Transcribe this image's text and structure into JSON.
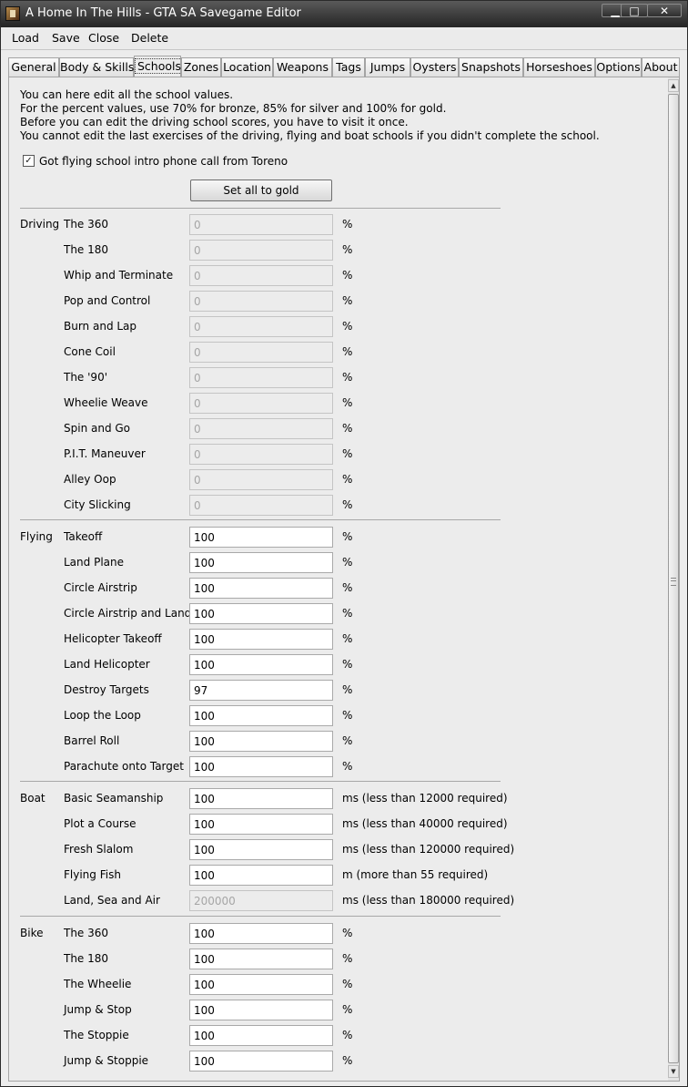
{
  "window": {
    "title": "A Home In The Hills - GTA SA Savegame Editor",
    "minimize": "▁",
    "maximize": "□",
    "close": "✕"
  },
  "menu": [
    "Load",
    "Save",
    "Close",
    "Delete"
  ],
  "tabs": [
    "General",
    "Body & Skills",
    "Schools",
    "Zones",
    "Location",
    "Weapons",
    "Tags",
    "Jumps",
    "Oysters",
    "Snapshots",
    "Horseshoes",
    "Options",
    "About"
  ],
  "active_tab": "Schools",
  "intro": [
    "You can here edit all the school values.",
    "For the percent values, use 70% for bronze, 85% for silver and 100% for gold.",
    "Before you can edit the driving school scores, you have to visit it once.",
    "You cannot edit the last exercises of the driving, flying and boat schools if you didn't complete the school."
  ],
  "phone_call_checkbox": {
    "label": "Got flying school intro phone call from Toreno",
    "checked": true,
    "mark": "✓"
  },
  "set_all_gold_label": "Set all to gold",
  "sections": [
    {
      "name": "Driving",
      "rows": [
        {
          "label": "The 360",
          "value": "0",
          "unit": "%",
          "disabled": true
        },
        {
          "label": "The 180",
          "value": "0",
          "unit": "%",
          "disabled": true
        },
        {
          "label": "Whip and Terminate",
          "value": "0",
          "unit": "%",
          "disabled": true
        },
        {
          "label": "Pop and Control",
          "value": "0",
          "unit": "%",
          "disabled": true
        },
        {
          "label": "Burn and Lap",
          "value": "0",
          "unit": "%",
          "disabled": true
        },
        {
          "label": "Cone Coil",
          "value": "0",
          "unit": "%",
          "disabled": true
        },
        {
          "label": "The '90'",
          "value": "0",
          "unit": "%",
          "disabled": true
        },
        {
          "label": "Wheelie Weave",
          "value": "0",
          "unit": "%",
          "disabled": true
        },
        {
          "label": "Spin and Go",
          "value": "0",
          "unit": "%",
          "disabled": true
        },
        {
          "label": "P.I.T. Maneuver",
          "value": "0",
          "unit": "%",
          "disabled": true
        },
        {
          "label": "Alley Oop",
          "value": "0",
          "unit": "%",
          "disabled": true
        },
        {
          "label": "City Slicking",
          "value": "0",
          "unit": "%",
          "disabled": true
        }
      ]
    },
    {
      "name": "Flying",
      "rows": [
        {
          "label": "Takeoff",
          "value": "100",
          "unit": "%",
          "disabled": false
        },
        {
          "label": "Land Plane",
          "value": "100",
          "unit": "%",
          "disabled": false
        },
        {
          "label": "Circle Airstrip",
          "value": "100",
          "unit": "%",
          "disabled": false
        },
        {
          "label": "Circle Airstrip and Land",
          "value": "100",
          "unit": "%",
          "disabled": false
        },
        {
          "label": "Helicopter Takeoff",
          "value": "100",
          "unit": "%",
          "disabled": false
        },
        {
          "label": "Land Helicopter",
          "value": "100",
          "unit": "%",
          "disabled": false
        },
        {
          "label": "Destroy Targets",
          "value": "97",
          "unit": "%",
          "disabled": false
        },
        {
          "label": "Loop the Loop",
          "value": "100",
          "unit": "%",
          "disabled": false
        },
        {
          "label": "Barrel Roll",
          "value": "100",
          "unit": "%",
          "disabled": false
        },
        {
          "label": "Parachute onto Target",
          "value": "100",
          "unit": "%",
          "disabled": false
        }
      ]
    },
    {
      "name": "Boat",
      "rows": [
        {
          "label": "Basic Seamanship",
          "value": "100",
          "unit": "ms (less than 12000 required)",
          "disabled": false
        },
        {
          "label": "Plot a Course",
          "value": "100",
          "unit": "ms (less than 40000 required)",
          "disabled": false
        },
        {
          "label": "Fresh Slalom",
          "value": "100",
          "unit": "ms (less than 120000 required)",
          "disabled": false
        },
        {
          "label": "Flying Fish",
          "value": "100",
          "unit": "m (more than 55 required)",
          "disabled": false
        },
        {
          "label": "Land, Sea and Air",
          "value": "200000",
          "unit": "ms (less than 180000 required)",
          "disabled": true
        }
      ]
    },
    {
      "name": "Bike",
      "rows": [
        {
          "label": "The 360",
          "value": "100",
          "unit": "%",
          "disabled": false
        },
        {
          "label": "The 180",
          "value": "100",
          "unit": "%",
          "disabled": false
        },
        {
          "label": "The Wheelie",
          "value": "100",
          "unit": "%",
          "disabled": false
        },
        {
          "label": "Jump & Stop",
          "value": "100",
          "unit": "%",
          "disabled": false
        },
        {
          "label": "The Stoppie",
          "value": "100",
          "unit": "%",
          "disabled": false
        },
        {
          "label": "Jump & Stoppie",
          "value": "100",
          "unit": "%",
          "disabled": false
        }
      ]
    }
  ],
  "scrollbar": {
    "up": "▲",
    "down": "▼"
  },
  "colors": {
    "titlebar": "#2e2e2e",
    "panel": "#ececec",
    "disabled_text": "#a6a6a6"
  }
}
